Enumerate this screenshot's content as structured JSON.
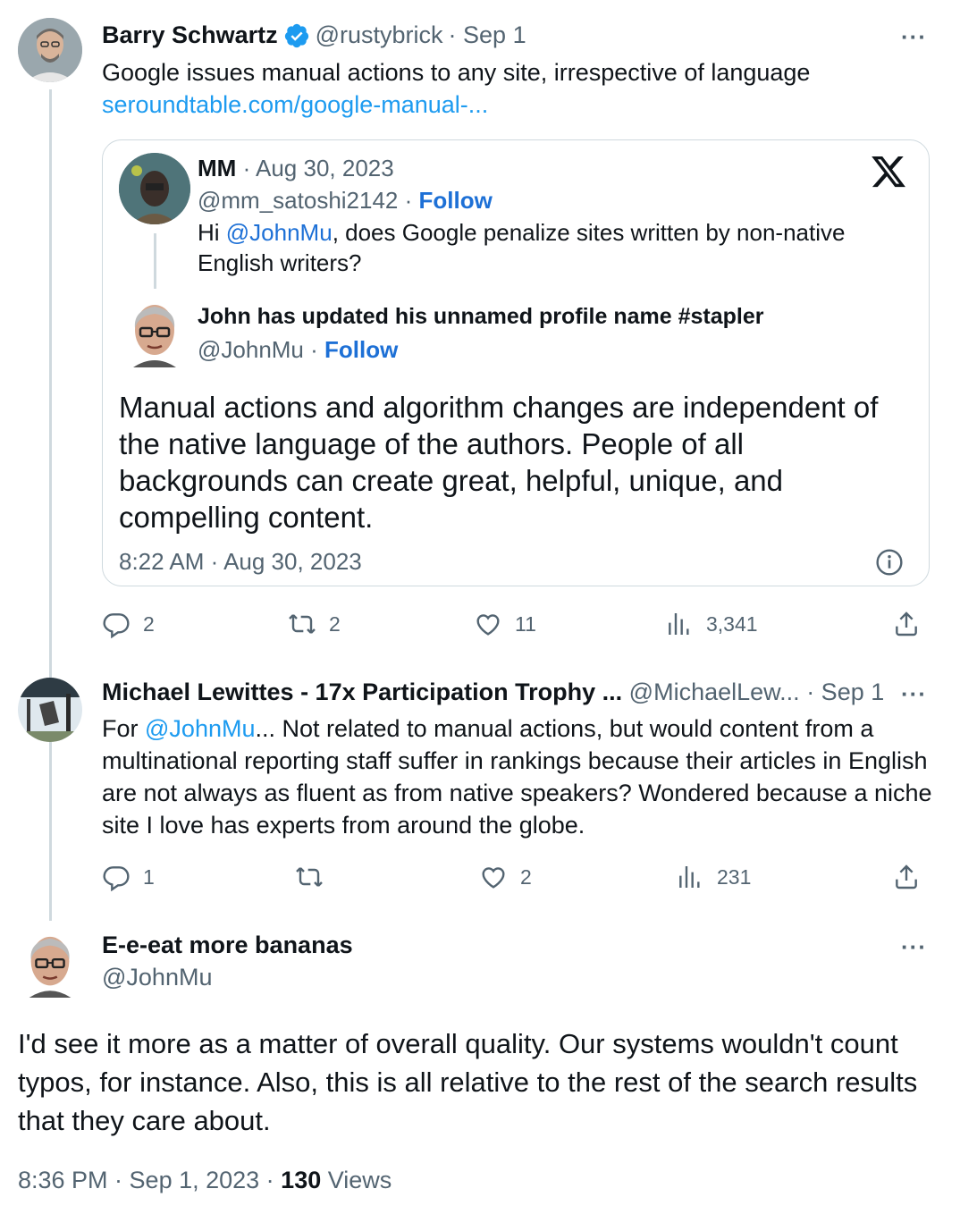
{
  "tweet1": {
    "author_name": "Barry Schwartz",
    "handle": "@rustybrick",
    "date": "· Sep 1",
    "text": "Google issues manual actions to any site, irrespective of  language",
    "link": "seroundtable.com/google-manual-...",
    "more": "···",
    "quote": {
      "q1_name": "MM",
      "q1_date": "· Aug 30, 2023",
      "q1_handle": "@mm_satoshi2142",
      "q1_sep": "·",
      "q1_follow": "Follow",
      "q1_text_pre": "Hi ",
      "q1_mention": "@JohnMu",
      "q1_text_post": ", does Google penalize sites written by non-native English writers?",
      "q2_name": "John has updated his unnamed profile name #stapler",
      "q2_handle": "@JohnMu",
      "q2_sep": "·",
      "q2_follow": "Follow",
      "q2_text": "Manual actions and algorithm changes are independent of the native language of the authors. People of all backgrounds can create great, helpful, unique, and compelling content.",
      "timestamp": "8:22 AM · Aug 30, 2023",
      "x_logo": "𝕏"
    },
    "actions": {
      "replies": "2",
      "reposts": "2",
      "likes": "11",
      "views": "3,341"
    }
  },
  "tweet2": {
    "author_name": "Michael Lewittes - 17x Participation Trophy ...",
    "handle": "@MichaelLew...",
    "date": "· Sep 1",
    "more": "···",
    "text_pre": "For ",
    "mention": "@JohnMu",
    "text_post": "... Not related to manual actions, but would content from a multinational reporting staff suffer in rankings because their articles in English are not always as fluent as from native speakers? Wondered because a niche site I love has experts from around the globe.",
    "actions": {
      "replies": "1",
      "reposts": "",
      "likes": "2",
      "views": "231"
    }
  },
  "tweet3": {
    "author_name": "E-e-eat more bananas",
    "handle": "@JohnMu",
    "more": "···",
    "text": "I'd see it more as a matter of overall quality. Our systems wouldn't count typos, for instance. Also, this is all relative to the rest of the search results that they care about.",
    "time": "8:36 PM · Sep 1, 2023 · ",
    "views_count": "130",
    "views_label": " Views"
  },
  "colors": {
    "link": "#1d9bf0",
    "follow": "#1d70d6",
    "verified": "#1d9bf0",
    "muted": "#536471"
  },
  "icons": [
    "verified-badge-icon",
    "reply-icon",
    "repost-icon",
    "like-icon",
    "views-icon",
    "share-icon",
    "info-icon",
    "x-logo-icon",
    "more-icon"
  ]
}
